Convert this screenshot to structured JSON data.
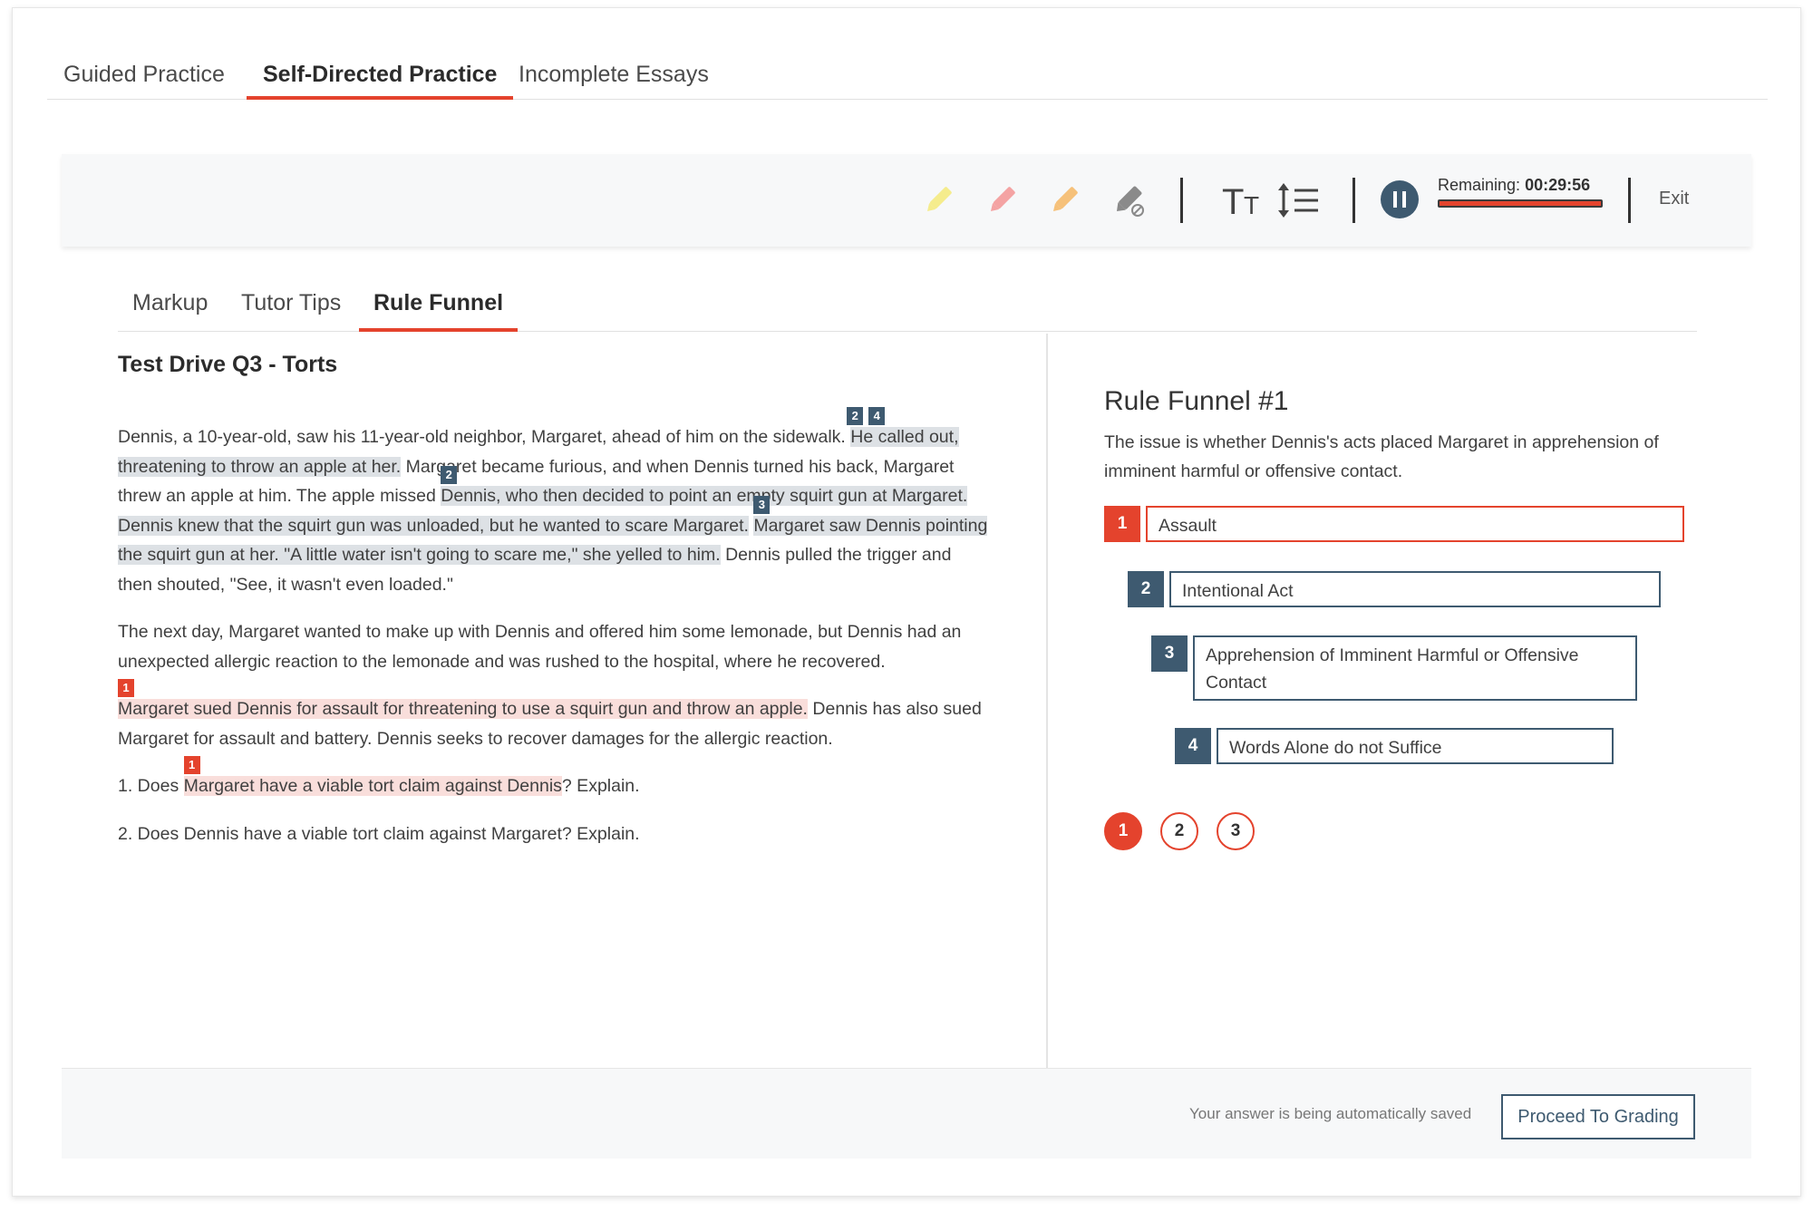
{
  "top_tabs": {
    "guided": "Guided Practice",
    "self_directed": "Self-Directed Practice",
    "incomplete": "Incomplete Essays"
  },
  "toolbar": {
    "icons": [
      "yellow-highlighter-icon",
      "pink-highlighter-icon",
      "orange-highlighter-icon",
      "eraser-icon",
      "text-size-icon",
      "line-spacing-icon",
      "pause-icon"
    ],
    "timer_label": "Remaining:",
    "timer_value": "00:29:56",
    "exit_label": "Exit"
  },
  "inner_tabs": {
    "markup": "Markup",
    "tutor_tips": "Tutor Tips",
    "rule_funnel": "Rule Funnel"
  },
  "document": {
    "title": "Test Drive Q3 - Torts",
    "p1_a": "Dennis, a 10-year-old, saw his 11-year-old neighbor, Margaret, ahead of him on the sidewalk.",
    "p1_hl1": "He called out, threatening to throw an apple at her.",
    "p1_b": "Margaret became furious, and when Dennis turned his back, Margaret threw an apple at him. The apple missed",
    "p1_hl2": "Dennis, who then decided to point an empty squirt gun at Margaret. Dennis knew that the squirt gun was unloaded, but he wanted to scare Margaret.",
    "p1_hl3": "Margaret saw Dennis pointing the squirt gun at her. \"A little water isn't going to scare me,\" she yelled to him.",
    "p1_c": "Dennis pulled the trigger and then shouted, \"See, it wasn't even loaded.\"",
    "p2": "The next day, Margaret wanted to make up with Dennis and offered him some lemonade, but Dennis had an unexpected allergic reaction to the lemonade and was rushed to the hospital, where he recovered.",
    "p3_hl": "Margaret sued Dennis for assault for threatening to use a squirt gun and throw an apple.",
    "p3_b": "Dennis has also sued Margaret for assault and battery. Dennis seeks to recover damages for the allergic reaction.",
    "q1_a": "1. Does",
    "q1_hl": "Margaret have a viable tort claim against Dennis",
    "q1_b": "? Explain.",
    "q2": "2. Does Dennis have a viable tort claim against Margaret? Explain.",
    "tags": {
      "t2a": "2",
      "t4": "4",
      "t2b": "2",
      "t3": "3",
      "t1a": "1",
      "t1b": "1"
    }
  },
  "funnel": {
    "title": "Rule Funnel #1",
    "issue": "The issue is whether Dennis's acts placed Margaret in apprehension of imminent harmful or offensive contact.",
    "items": [
      {
        "num": "1",
        "label": "Assault"
      },
      {
        "num": "2",
        "label": "Intentional Act"
      },
      {
        "num": "3",
        "label": "Apprehension of Imminent Harmful or Offensive Contact"
      },
      {
        "num": "4",
        "label": "Words Alone do not Suffice"
      }
    ],
    "pages": [
      "1",
      "2",
      "3"
    ]
  },
  "footer": {
    "autosave": "Your answer is being automatically saved",
    "proceed": "Proceed To Grading"
  },
  "colors": {
    "accent": "#e4432d",
    "navy": "#3e5a70",
    "highlight_gray": "#dde1e5",
    "highlight_pink": "#f9dedb"
  }
}
